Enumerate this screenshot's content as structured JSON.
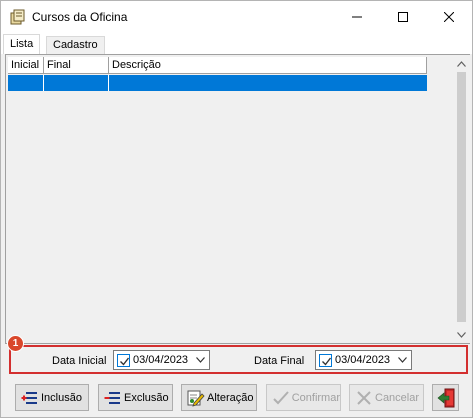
{
  "window": {
    "title": "Cursos da Oficina"
  },
  "tabs": [
    {
      "label": "Lista"
    },
    {
      "label": "Cadastro"
    }
  ],
  "grid": {
    "columns": [
      {
        "label": "Inicial"
      },
      {
        "label": "Final"
      },
      {
        "label": "Descrição"
      }
    ],
    "selected_row_color": "#0078d7"
  },
  "filter": {
    "badge": "1",
    "data_inicial": {
      "label": "Data Inicial",
      "value": "03/04/2023",
      "checked": true
    },
    "data_final": {
      "label": "Data Final",
      "value": "03/04/2023",
      "checked": true
    },
    "highlight_color": "#d32f2f"
  },
  "buttons": {
    "inclusao": {
      "label": "Inclusão",
      "enabled": true,
      "icon": "add-icon"
    },
    "exclusao": {
      "label": "Exclusão",
      "enabled": true,
      "icon": "delete-icon"
    },
    "alteracao": {
      "label": "Alteração",
      "enabled": true,
      "icon": "edit-icon"
    },
    "confirmar": {
      "label": "Confirmar",
      "enabled": false,
      "icon": "check-icon"
    },
    "cancelar": {
      "label": "Cancelar",
      "enabled": false,
      "icon": "cancel-icon"
    },
    "sair": {
      "icon": "exit-door-icon"
    }
  }
}
